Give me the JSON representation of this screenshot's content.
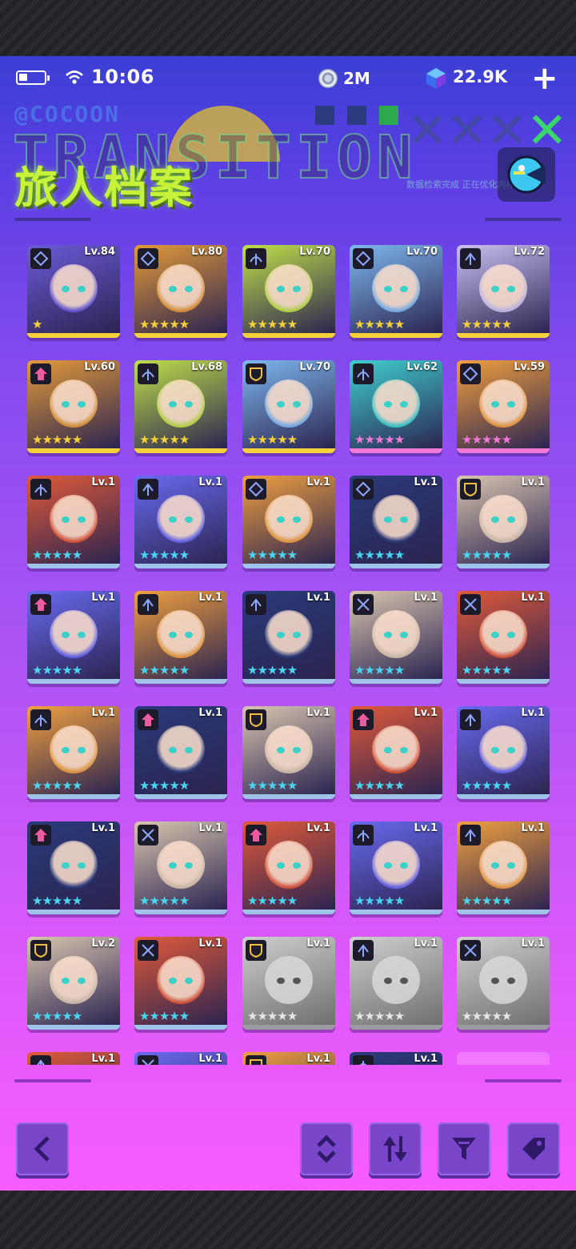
{
  "status_bar": {
    "time": "10:06",
    "coins": "2M",
    "gems": "22.9K"
  },
  "header": {
    "title": "旅人档案",
    "deco_brand": "@COCOON",
    "deco_word": "TRANSITION",
    "deco_small": "数据检索完成 正在优化内存"
  },
  "colors": {
    "accent_green": "#c8f23a",
    "button": "#7a46c9",
    "gold": "#f5d03a",
    "pink": "#f07ad8"
  },
  "rows": [
    [
      {
        "level": "Lv.84",
        "rarity": "gold",
        "stars": "★",
        "class_icon": "diamond-icon"
      },
      {
        "level": "Lv.80",
        "rarity": "gold",
        "stars": "★★★★★",
        "class_icon": "diamond-icon"
      },
      {
        "level": "Lv.70",
        "rarity": "gold",
        "stars": "★★★★★",
        "class_icon": "bow-icon"
      },
      {
        "level": "Lv.70",
        "rarity": "gold",
        "stars": "★★★★★",
        "class_icon": "diamond-icon"
      },
      {
        "level": "Lv.72",
        "rarity": "gold",
        "stars": "★★★★★",
        "class_icon": "arrow-icon"
      }
    ],
    [
      {
        "level": "Lv.60",
        "rarity": "gold",
        "stars": "★★★★★",
        "class_icon": "house-icon"
      },
      {
        "level": "Lv.68",
        "rarity": "gold",
        "stars": "★★★★★",
        "class_icon": "bow-icon"
      },
      {
        "level": "Lv.70",
        "rarity": "gold",
        "stars": "★★★★★",
        "class_icon": "shield-icon"
      },
      {
        "level": "Lv.62",
        "rarity": "pink",
        "stars": "★★★★★",
        "class_icon": "bow-icon"
      },
      {
        "level": "Lv.59",
        "rarity": "pink",
        "stars": "★★★★★",
        "class_icon": "diamond-icon"
      }
    ],
    [
      {
        "level": "Lv.1",
        "rarity": "blue",
        "stars": "★★★★★",
        "class_icon": "bow-icon"
      },
      {
        "level": "Lv.1",
        "rarity": "blue",
        "stars": "★★★★★",
        "class_icon": "arrow-icon"
      },
      {
        "level": "Lv.1",
        "rarity": "blue",
        "stars": "★★★★★",
        "class_icon": "diamond-icon"
      },
      {
        "level": "Lv.1",
        "rarity": "blue",
        "stars": "★★★★★",
        "class_icon": "diamond-icon"
      },
      {
        "level": "Lv.1",
        "rarity": "blue",
        "stars": "★★★★★",
        "class_icon": "shield-icon"
      }
    ],
    [
      {
        "level": "Lv.1",
        "rarity": "blue",
        "stars": "★★★★★",
        "class_icon": "house-icon"
      },
      {
        "level": "Lv.1",
        "rarity": "blue",
        "stars": "★★★★★",
        "class_icon": "arrow-icon"
      },
      {
        "level": "Lv.1",
        "rarity": "blue",
        "stars": "★★★★★",
        "class_icon": "arrow-icon"
      },
      {
        "level": "Lv.1",
        "rarity": "blue",
        "stars": "★★★★★",
        "class_icon": "swords-icon"
      },
      {
        "level": "Lv.1",
        "rarity": "blue",
        "stars": "★★★★★",
        "class_icon": "swords-icon"
      }
    ],
    [
      {
        "level": "Lv.1",
        "rarity": "blue",
        "stars": "★★★★★",
        "class_icon": "bow-icon"
      },
      {
        "level": "Lv.1",
        "rarity": "blue",
        "stars": "★★★★★",
        "class_icon": "house-icon"
      },
      {
        "level": "Lv.1",
        "rarity": "blue",
        "stars": "★★★★★",
        "class_icon": "shield-icon"
      },
      {
        "level": "Lv.1",
        "rarity": "blue",
        "stars": "★★★★★",
        "class_icon": "house-icon"
      },
      {
        "level": "Lv.1",
        "rarity": "blue",
        "stars": "★★★★★",
        "class_icon": "arrow-icon"
      }
    ],
    [
      {
        "level": "Lv.1",
        "rarity": "blue",
        "stars": "★★★★★",
        "class_icon": "house-icon"
      },
      {
        "level": "Lv.1",
        "rarity": "blue",
        "stars": "★★★★★",
        "class_icon": "swords-icon"
      },
      {
        "level": "Lv.1",
        "rarity": "blue",
        "stars": "★★★★★",
        "class_icon": "house-icon"
      },
      {
        "level": "Lv.1",
        "rarity": "blue",
        "stars": "★★★★★",
        "class_icon": "bow-icon"
      },
      {
        "level": "Lv.1",
        "rarity": "blue",
        "stars": "★★★★★",
        "class_icon": "arrow-icon"
      }
    ],
    [
      {
        "level": "Lv.2",
        "rarity": "blue",
        "stars": "★★★★★",
        "class_icon": "shield-icon"
      },
      {
        "level": "Lv.1",
        "rarity": "blue",
        "stars": "★★★★★",
        "class_icon": "swords-icon"
      },
      {
        "level": "Lv.1",
        "rarity": "gray",
        "stars": "★★★★★",
        "class_icon": "shield-icon"
      },
      {
        "level": "Lv.1",
        "rarity": "gray",
        "stars": "★★★★★",
        "class_icon": "arrow-icon"
      },
      {
        "level": "Lv.1",
        "rarity": "gray",
        "stars": "★★★★★",
        "class_icon": "swords-icon"
      }
    ],
    [
      {
        "level": "Lv.1",
        "rarity": "blue",
        "stars": "",
        "class_icon": "arrow-icon"
      },
      {
        "level": "Lv.1",
        "rarity": "blue",
        "stars": "",
        "class_icon": "swords-icon"
      },
      {
        "level": "Lv.1",
        "rarity": "blue",
        "stars": "",
        "class_icon": "shield-icon"
      },
      {
        "level": "Lv.1",
        "rarity": "blue",
        "stars": "",
        "class_icon": "bow-icon"
      }
    ]
  ],
  "toolbar": {
    "back": "back-icon",
    "order": "sort-order-icon",
    "swap": "swap-sort-icon",
    "filter": "filter-icon",
    "tag": "tag-icon"
  }
}
